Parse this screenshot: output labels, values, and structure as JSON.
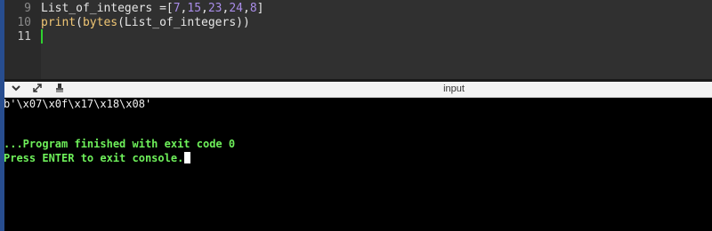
{
  "editor": {
    "line_numbers": [
      "9",
      "10",
      "11"
    ],
    "lines": [
      {
        "tokens": [
          {
            "text": "List_of_integers ",
            "color": "#e6e6e6"
          },
          {
            "text": "=",
            "color": "#e6e6e6"
          },
          {
            "text": "[",
            "color": "#e6e6e6"
          },
          {
            "text": "7",
            "color": "#a98de8"
          },
          {
            "text": ",",
            "color": "#e6e6e6"
          },
          {
            "text": "15",
            "color": "#a98de8"
          },
          {
            "text": ",",
            "color": "#e6e6e6"
          },
          {
            "text": "23",
            "color": "#a98de8"
          },
          {
            "text": ",",
            "color": "#e6e6e6"
          },
          {
            "text": "24",
            "color": "#a98de8"
          },
          {
            "text": ",",
            "color": "#e6e6e6"
          },
          {
            "text": "8",
            "color": "#a98de8"
          },
          {
            "text": "]",
            "color": "#e6e6e6"
          }
        ]
      },
      {
        "tokens": [
          {
            "text": "print",
            "color": "#f0c674"
          },
          {
            "text": "(",
            "color": "#e6e6e6"
          },
          {
            "text": "bytes",
            "color": "#f0c674"
          },
          {
            "text": "(List_of_integers))",
            "color": "#e6e6e6"
          }
        ]
      },
      {
        "tokens": []
      }
    ]
  },
  "panel": {
    "title": "input",
    "icons": [
      "chevron-down-icon",
      "expand-icon",
      "clear-console-icon"
    ]
  },
  "console": {
    "output": "b'\\x07\\x0f\\x17\\x18\\x08'",
    "status_line_1": "...Program finished with exit code 0",
    "status_line_2": "Press ENTER to exit console."
  },
  "colors": {
    "accent_strip": "#274d8f",
    "status_text": "#6ef05a",
    "number_literal": "#a98de8",
    "builtin_function": "#f0c674"
  }
}
